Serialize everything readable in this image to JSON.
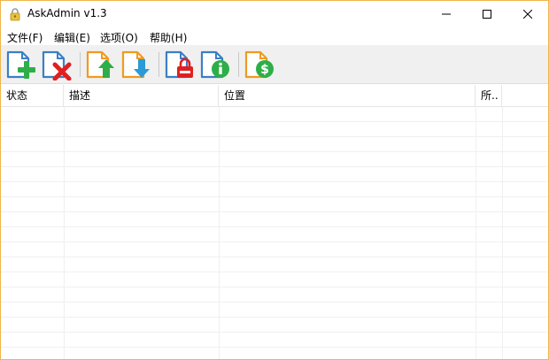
{
  "window": {
    "title": "AskAdmin v1.3",
    "accent_color": "#f0b64a",
    "app_icon": "padlock-icon",
    "controls": {
      "minimize_icon": "minimize-icon",
      "maximize_icon": "maximize-icon",
      "close_icon": "close-icon"
    }
  },
  "menu": {
    "items": [
      {
        "label": "文件(F)"
      },
      {
        "label": "编辑(E)"
      },
      {
        "label": "选项(O)"
      },
      {
        "label": "帮助(H)"
      }
    ]
  },
  "toolbar": {
    "buttons": [
      {
        "icon": "add-file-icon"
      },
      {
        "icon": "remove-file-icon"
      },
      {
        "icon": "import-icon"
      },
      {
        "icon": "export-icon"
      },
      {
        "icon": "lock-file-icon"
      },
      {
        "icon": "info-file-icon"
      },
      {
        "icon": "donate-file-icon"
      }
    ]
  },
  "table": {
    "columns": [
      {
        "label": "状态"
      },
      {
        "label": "描述"
      },
      {
        "label": "位置"
      },
      {
        "label": "所.."
      }
    ],
    "rows": []
  }
}
